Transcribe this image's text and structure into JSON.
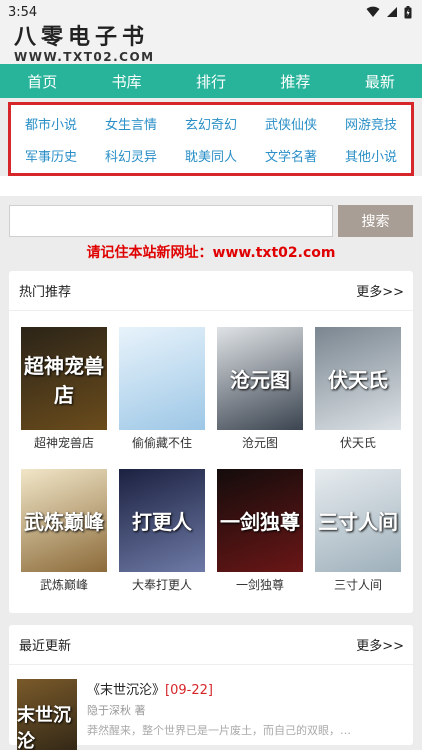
{
  "status": {
    "time": "3:54"
  },
  "header": {
    "logo_main": "八零电子书",
    "logo_url": "WWW.TXT02.COM"
  },
  "nav": [
    "首页",
    "书库",
    "排行",
    "推荐",
    "最新"
  ],
  "categories": [
    "都市小说",
    "女生言情",
    "玄幻奇幻",
    "武侠仙侠",
    "网游竞技",
    "军事历史",
    "科幻灵异",
    "耽美同人",
    "文学名著",
    "其他小说"
  ],
  "search": {
    "button": "搜索",
    "placeholder": ""
  },
  "notice": "请记住本站新网址：www.txt02.com",
  "hot": {
    "title": "热门推荐",
    "more": "更多>>",
    "books": [
      {
        "name": "超神宠兽店",
        "cover_text": "超神宠兽店",
        "colors": [
          "#2b2418",
          "#6b4c1c"
        ]
      },
      {
        "name": "偷偷藏不住",
        "cover_text": "",
        "colors": [
          "#e8f3fb",
          "#9dc7e6"
        ]
      },
      {
        "name": "沧元图",
        "cover_text": "沧元图",
        "colors": [
          "#dfe3e6",
          "#3b4450"
        ]
      },
      {
        "name": "伏天氏",
        "cover_text": "伏天氏",
        "colors": [
          "#7a8690",
          "#dde3e7"
        ]
      },
      {
        "name": "武炼巅峰",
        "cover_text": "武炼巅峰",
        "colors": [
          "#f1e6c8",
          "#8c6b3a"
        ]
      },
      {
        "name": "大奉打更人",
        "cover_text": "打更人",
        "colors": [
          "#1b2140",
          "#6e7aa6"
        ]
      },
      {
        "name": "一剑独尊",
        "cover_text": "一剑独尊",
        "colors": [
          "#140c0c",
          "#6a1616"
        ]
      },
      {
        "name": "三寸人间",
        "cover_text": "三寸人间",
        "colors": [
          "#e7ecef",
          "#9eb0bb"
        ]
      }
    ]
  },
  "recent": {
    "title": "最近更新",
    "more": "更多>>",
    "item": {
      "title": "《末世沉沦》",
      "chapter": "[09-22]",
      "author": "隐于深秋 著",
      "desc": "莽然醒来，整个世界已是一片废土，而自己的双眼，也变成了……",
      "cover_text": "末世沉沦"
    }
  }
}
